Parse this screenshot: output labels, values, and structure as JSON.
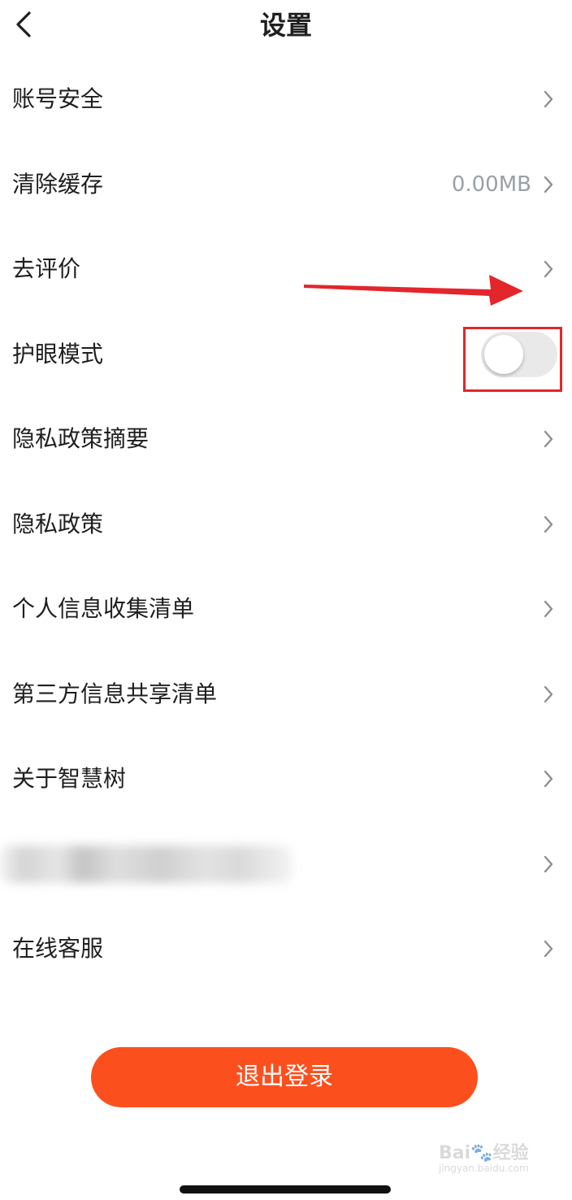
{
  "header": {
    "title": "设置"
  },
  "settings": {
    "items": [
      {
        "label": "账号安全"
      },
      {
        "label": "清除缓存",
        "value": "0.00MB"
      },
      {
        "label": "去评价"
      },
      {
        "label": "护眼模式",
        "toggle_on": false
      },
      {
        "label": "隐私政策摘要"
      },
      {
        "label": "隐私政策"
      },
      {
        "label": "个人信息收集清单"
      },
      {
        "label": "第三方信息共享清单"
      },
      {
        "label": "关于智慧树"
      },
      {
        "label": ""
      },
      {
        "label": "在线客服"
      }
    ]
  },
  "footer": {
    "logout_label": "退出登录"
  },
  "watermark": {
    "logo": "Bai经验",
    "url": "jingyan.baidu.com"
  },
  "colors": {
    "accent": "#fc4f1e",
    "annotation": "#e2262c",
    "toggle_off": "#e9e9ea"
  }
}
